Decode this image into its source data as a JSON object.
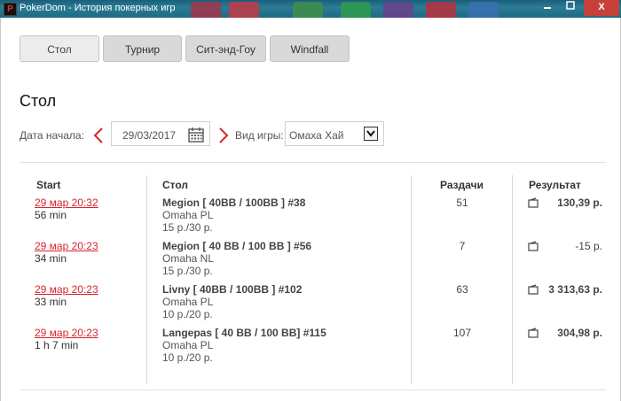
{
  "window": {
    "app_icon_letter": "P",
    "title": "PokerDom - История покерных игр",
    "close_label": "X"
  },
  "tabs": [
    {
      "label": "Стол",
      "active": true
    },
    {
      "label": "Турнир",
      "active": false
    },
    {
      "label": "Сит-энд-Гоу",
      "active": false
    },
    {
      "label": "Windfall",
      "active": false
    }
  ],
  "section_title": "Стол",
  "filters": {
    "start_date_label": "Дата начала:",
    "start_date_value": "29/03/2017",
    "game_type_label": "Вид игры:",
    "game_type_value": "Омаха Хай"
  },
  "columns": {
    "start": "Start",
    "table": "Стол",
    "hands": "Раздачи",
    "result": "Результат"
  },
  "rows": [
    {
      "time": "29 мар 20:32",
      "duration": "56 min",
      "table": "Megion [ 40BB / 100BB ] #38",
      "game": "Omaha PL",
      "stakes": "15 р./30 р.",
      "hands": "51",
      "result": "130,39 р.",
      "result_bold": true
    },
    {
      "time": "29 мар 20:23",
      "duration": "34 min",
      "table": "Megion [ 40 BB / 100 BB ] #56",
      "game": "Omaha NL",
      "stakes": "15 р./30 р.",
      "hands": "7",
      "result": "-15 р.",
      "result_bold": false
    },
    {
      "time": "29 мар 20:23",
      "duration": "33 min",
      "table": "Livny [ 40BB / 100BB ] #102",
      "game": "Omaha PL",
      "stakes": "10 р./20 р.",
      "hands": "63",
      "result": "3 313,63 р.",
      "result_bold": true
    },
    {
      "time": "29 мар 20:23",
      "duration": "1 h 7 min",
      "table": "Langepas [ 40 BB / 100 BB] #115",
      "game": "Omaha PL",
      "stakes": "10 р./20 р.",
      "hands": "107",
      "result": "304,98 р.",
      "result_bold": true
    }
  ],
  "colors": {
    "accent_red": "#d8232a",
    "titlebar": "#1f6d87"
  },
  "icons": {
    "prev": "chevron-left-icon",
    "next": "chevron-right-icon",
    "calendar": "calendar-icon",
    "dropdown": "chevron-down-icon",
    "result": "wallet-icon"
  }
}
